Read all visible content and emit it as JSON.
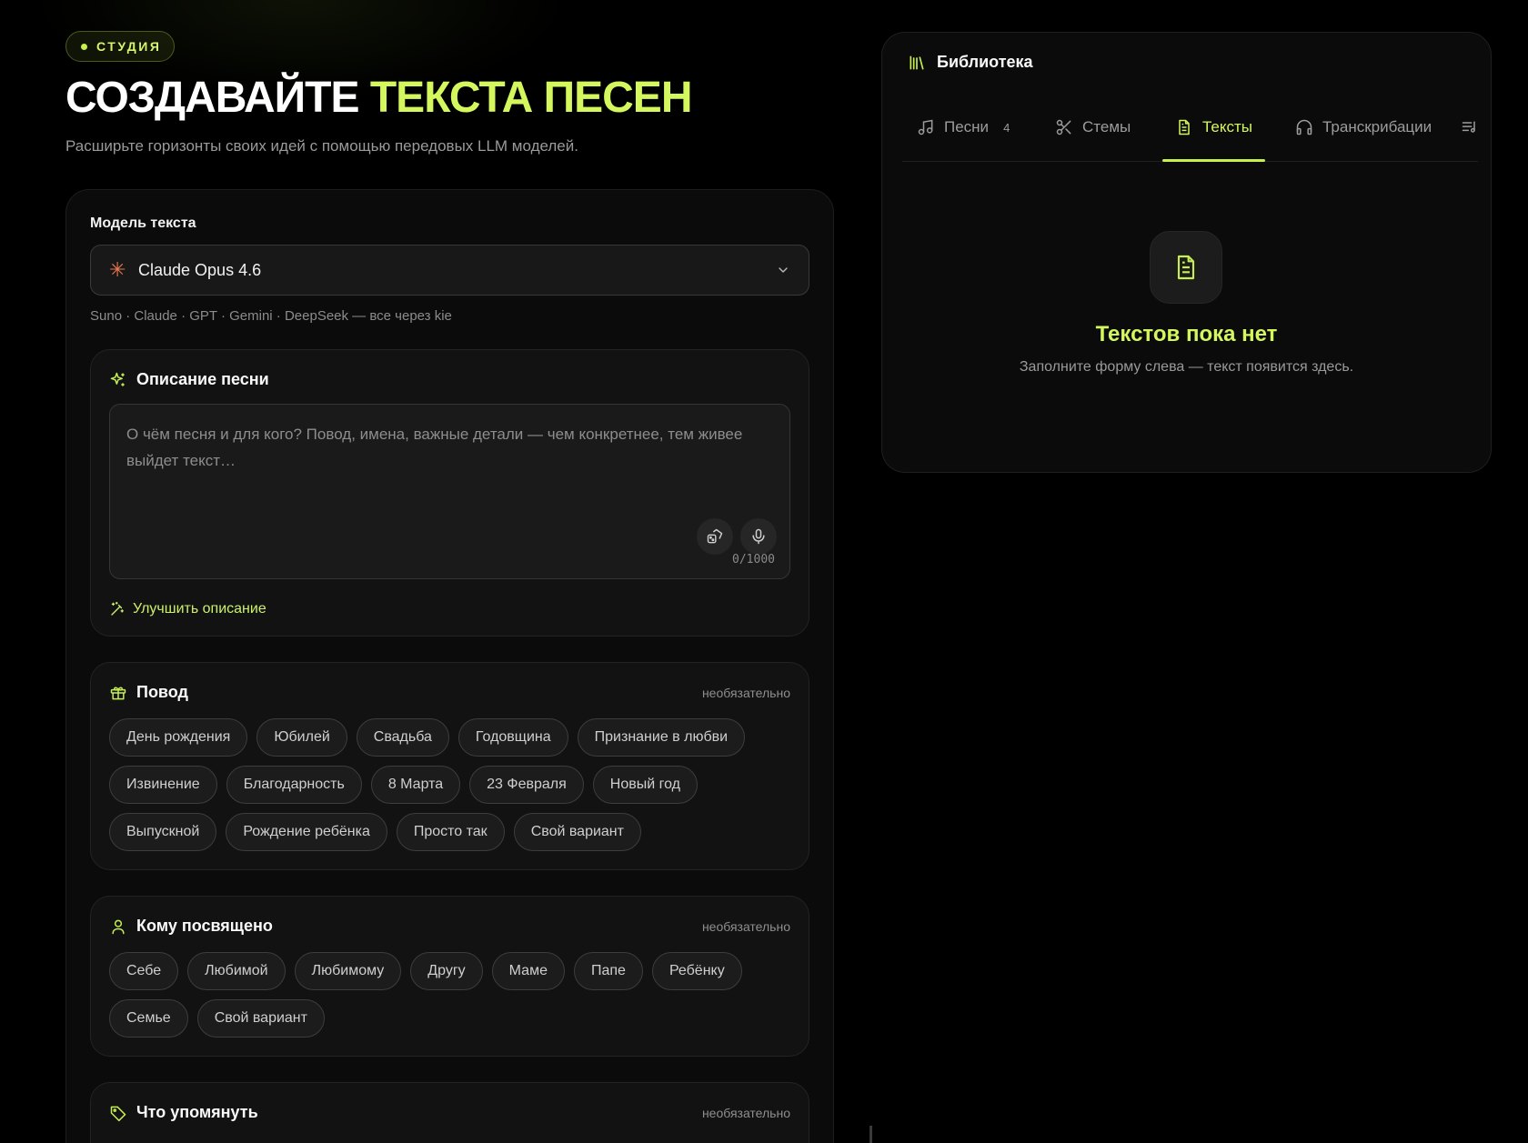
{
  "studio_badge": "СТУДИЯ",
  "hero": {
    "title_plain": "СОЗДАВАЙТЕ",
    "title_accent": "ТЕКСТА ПЕСЕН",
    "subtitle": "Расширьте горизонты своих идей с помощью передовых LLM моделей."
  },
  "model": {
    "label": "Модель текста",
    "selected": "Claude Opus 4.6",
    "providers_note": "Suno · Claude · GPT · Gemini · DeepSeek — все через kie"
  },
  "description": {
    "title": "Описание песни",
    "placeholder": "О чём песня и для кого? Повод, имена, важные детали — чем конкретнее, тем живее выйдет текст…",
    "counter": "0/1000",
    "improve_label": "Улучшить описание"
  },
  "occasion": {
    "title": "Повод",
    "optional": "необязательно",
    "chips": [
      "День рождения",
      "Юбилей",
      "Свадьба",
      "Годовщина",
      "Признание в любви",
      "Извинение",
      "Благодарность",
      "8 Марта",
      "23 Февраля",
      "Новый год",
      "Выпускной",
      "Рождение ребёнка",
      "Просто так",
      "Свой вариант"
    ]
  },
  "dedication": {
    "title": "Кому посвящено",
    "optional": "необязательно",
    "chips": [
      "Себе",
      "Любимой",
      "Любимому",
      "Другу",
      "Маме",
      "Папе",
      "Ребёнку",
      "Семье",
      "Свой вариант"
    ]
  },
  "mention": {
    "title": "Что упомянуть",
    "optional": "необязательно"
  },
  "library": {
    "title": "Библиотека",
    "tabs": [
      {
        "label": "Песни",
        "count": "4",
        "icon": "music-note-icon"
      },
      {
        "label": "Стемы",
        "icon": "scissors-icon"
      },
      {
        "label": "Тексты",
        "icon": "document-icon",
        "active": true
      },
      {
        "label": "Транскрибации",
        "icon": "headphones-icon"
      }
    ],
    "empty_title": "Текстов пока нет",
    "empty_subtitle": "Заполните форму слева — текст появится здесь."
  },
  "colors": {
    "accent": "#d4f75e",
    "background": "#000000",
    "card": "#0b0b0b",
    "chip_bg": "#1c1c1c",
    "model_icon": "#e8794f"
  }
}
